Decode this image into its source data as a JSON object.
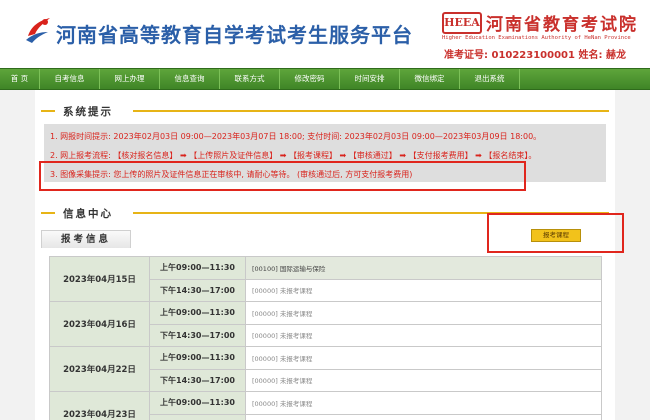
{
  "header": {
    "site_title": "河南省高等教育自学考试考生服务平台",
    "brand_badge": "HEEA",
    "brand_cn": "河南省教育考试院",
    "brand_en": "Higher Education Examinations Authority of HeNan Province",
    "user_info": "准考证号: 010223100001   姓名: 赫龙"
  },
  "nav": {
    "items": [
      {
        "label": "首  页"
      },
      {
        "label": "自考信息"
      },
      {
        "label": "网上办理"
      },
      {
        "label": "信息查询"
      },
      {
        "label": "联系方式"
      },
      {
        "label": "修改密码"
      },
      {
        "label": "时间安排"
      },
      {
        "label": "微信绑定"
      },
      {
        "label": "退出系统"
      }
    ]
  },
  "notice": {
    "title": "系统提示",
    "lines": [
      "1. 网报时间提示: 2023年02月03日 09:00—2023年03月07日 18:00; 支付时间: 2023年02月03日 09:00—2023年03月09日 18:00。",
      "2. 网上报考流程: 【核对报名信息】 ➡ 【上传照片及证件信息】 ➡ 【报考课程】 ➡ 【审核通过】 ➡ 【支付报考费用】 ➡ 【报名结束】。",
      "3. 图像采集提示: 您上传的照片及证件信息正在审核中, 请耐心等待。 (审核通过后, 方可支付报考费用)"
    ]
  },
  "info": {
    "title": "信息中心",
    "tab_label": "报考信息",
    "enroll_button": "报考课程"
  },
  "schedule": [
    {
      "date": "2023年04月15日",
      "am_time": "上午09:00—11:30",
      "am_course": "[00100] 国际运输与保险",
      "pm_time": "下午14:30—17:00",
      "pm_course": "[00000] 未报考课程"
    },
    {
      "date": "2023年04月16日",
      "am_time": "上午09:00—11:30",
      "am_course": "[00000] 未报考课程",
      "pm_time": "下午14:30—17:00",
      "pm_course": "[00000] 未报考课程"
    },
    {
      "date": "2023年04月22日",
      "am_time": "上午09:00—11:30",
      "am_course": "[00000] 未报考课程",
      "pm_time": "下午14:30—17:00",
      "pm_course": "[00000] 未报考课程"
    },
    {
      "date": "2023年04月23日",
      "am_time": "上午09:00—11:30",
      "am_course": "[00000] 未报考课程",
      "pm_time": "",
      "pm_course": ""
    }
  ],
  "colors": {
    "title_blue": "#2b5fa8",
    "brand_red": "#c9302c",
    "nav_green": "#4a922e",
    "notice_red": "#d9231c",
    "accent_yellow": "#e7b416",
    "annotation_red": "#e0261d"
  }
}
